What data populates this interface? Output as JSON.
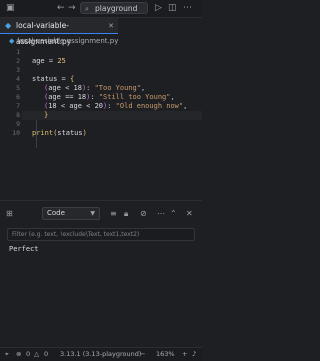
{
  "titlebar": {
    "search_text": "playground",
    "icons": [
      "sidebar-toggle-icon",
      "back-icon",
      "forward-icon",
      "search-icon",
      "run-icon",
      "split-editor-icon",
      "more-icon"
    ]
  },
  "tabs": [
    {
      "label": "local-variable-assignment.py",
      "active": true
    }
  ],
  "breadcrumb": {
    "file": "local-variable-assignment.py"
  },
  "editor": {
    "lines": [
      {
        "n": "1"
      },
      {
        "n": "2"
      },
      {
        "n": "3"
      },
      {
        "n": "4"
      },
      {
        "n": "5"
      },
      {
        "n": "6"
      },
      {
        "n": "7"
      },
      {
        "n": "8"
      },
      {
        "n": "9"
      },
      {
        "n": "10"
      }
    ],
    "code": {
      "l2_var": "age",
      "l2_op": " = ",
      "l2_num": "25",
      "l4_var": "status",
      "l4_op": " = ",
      "l4_brace": "{",
      "l5_open": "(",
      "l5_expr": "age < 18",
      "l5_close": ")",
      "l5_colon": ": ",
      "l5_str": "\"Too Young\"",
      "l5_comma": ",",
      "l6_open": "(",
      "l6_expr": "age == 18",
      "l6_close": ")",
      "l6_colon": ": ",
      "l6_str": "\"Still too Young\"",
      "l6_comma": ",",
      "l7_open": "(",
      "l7_expr": "18 < age < 20",
      "l7_close": ")",
      "l7_colon": ": ",
      "l7_str": "\"Old enough now\"",
      "l7_comma": ",",
      "l8_brace": "}",
      "l10_fn": "print",
      "l10_open": "(",
      "l10_arg": "status",
      "l10_close": ")"
    }
  },
  "panel": {
    "dropdown_value": "Code",
    "filter_placeholder": "Filter (e.g. text, !exclude\\Text, text1,text2)",
    "output": "Perfect"
  },
  "statusbar": {
    "errors": "0",
    "warnings": "0",
    "python": "3.13.1 (3.13-playground)",
    "zoom": "163%"
  },
  "colors": {
    "background": "#1e1f22",
    "accent": "#3b82f6",
    "string": "#c89b6d",
    "number": "#e5c07b"
  }
}
